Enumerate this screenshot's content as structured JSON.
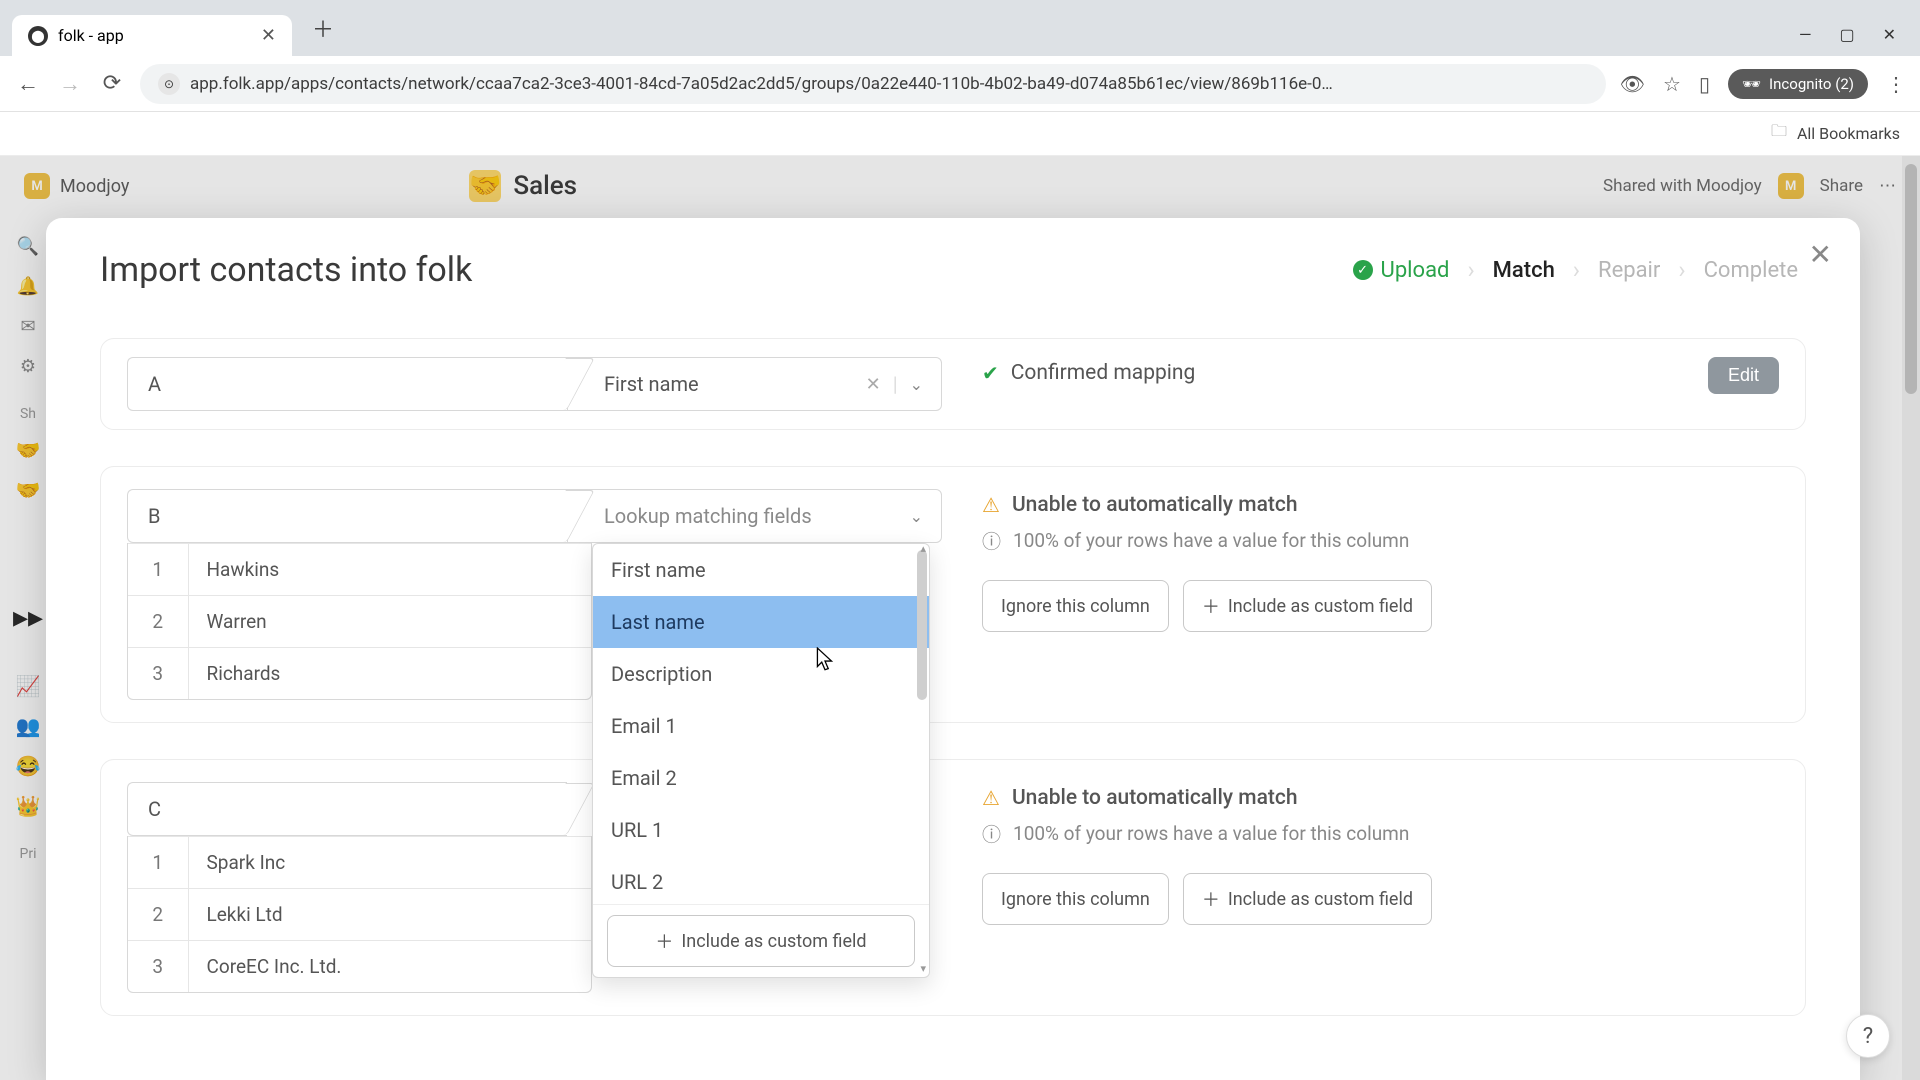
{
  "browser": {
    "tab_title": "folk - app",
    "url": "app.folk.app/apps/contacts/network/ccaa7ca2-3ce3-4001-84cd-7a05d2ac2dd5/groups/0a22e440-110b-4b02-ba49-d074a85b61ec/view/869b116e-0…",
    "incognito_label": "Incognito (2)",
    "bookmarks_label": "All Bookmarks"
  },
  "app": {
    "workspace": "Moodjoy",
    "page_title": "Sales",
    "shared_label": "Shared with Moodjoy",
    "share_button": "Share",
    "left_section_label_1": "Sh",
    "left_section_label_2": "Pri"
  },
  "modal": {
    "title": "Import contacts into folk",
    "steps": {
      "upload": "Upload",
      "match": "Match",
      "repair": "Repair",
      "complete": "Complete"
    },
    "confirmed_mapping": "Confirmed mapping",
    "unable_match": "Unable to automatically match",
    "rows_info": "100% of your rows have a value for this column",
    "ignore_btn": "Ignore this column",
    "include_custom_btn": "Include as custom field",
    "edit_btn": "Edit",
    "lookup_placeholder": "Lookup matching fields",
    "columnA": {
      "letter": "A",
      "mapped": "First name"
    },
    "columnB": {
      "letter": "B",
      "rows": [
        "Hawkins",
        "Warren",
        "Richards"
      ]
    },
    "columnC": {
      "letter": "C",
      "rows": [
        "Spark Inc",
        "Lekki Ltd",
        "CoreEC Inc. Ltd."
      ]
    },
    "dropdown_options": [
      "First name",
      "Last name",
      "Description",
      "Email 1",
      "Email 2",
      "URL 1",
      "URL 2"
    ],
    "dropdown_highlight_index": 1
  },
  "help_label": "?"
}
